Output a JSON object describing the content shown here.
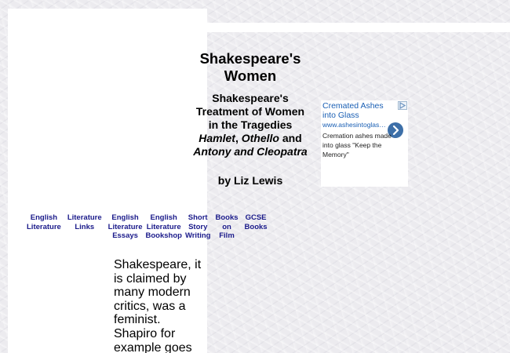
{
  "title": {
    "line1": "Shakespeare's",
    "line2": "Women"
  },
  "subtitle": {
    "prefix": "Shakespeare's Treatment of Women in the Tragedies ",
    "work1": "Hamlet",
    "sep1": ", ",
    "work2": "Othello",
    "and1": " and ",
    "work3": "Antony and Cleopatra"
  },
  "author": "by Liz Lewis",
  "ad": {
    "title": "Cremated Ashes into Glass",
    "url": "www.ashesintoglass.co.uk",
    "description": "Cremation ashes made into glass \"Keep the Memory\"",
    "badge_icon": "adchoices-icon",
    "arrow_icon": "chevron-right-icon",
    "arrow_color": "#3d6fa8"
  },
  "nav": [
    {
      "lines": [
        "English",
        "Literature"
      ]
    },
    {
      "lines": [
        "Literature",
        "Links"
      ]
    },
    {
      "lines": [
        "English",
        "Literature",
        "Essays"
      ]
    },
    {
      "lines": [
        "English",
        "Literature",
        "Bookshop"
      ]
    },
    {
      "lines": [
        "Short",
        "Story",
        "Writing"
      ]
    },
    {
      "lines": [
        "Books",
        "on",
        "Film"
      ]
    },
    {
      "lines": [
        "GCSE",
        "Books"
      ]
    }
  ],
  "body_text": "Shakespeare, it is claimed by many modern critics, was a feminist. Shapiro for example goes",
  "colors": {
    "link": "#1a1a8a",
    "ad_link": "#1a5fb4"
  }
}
